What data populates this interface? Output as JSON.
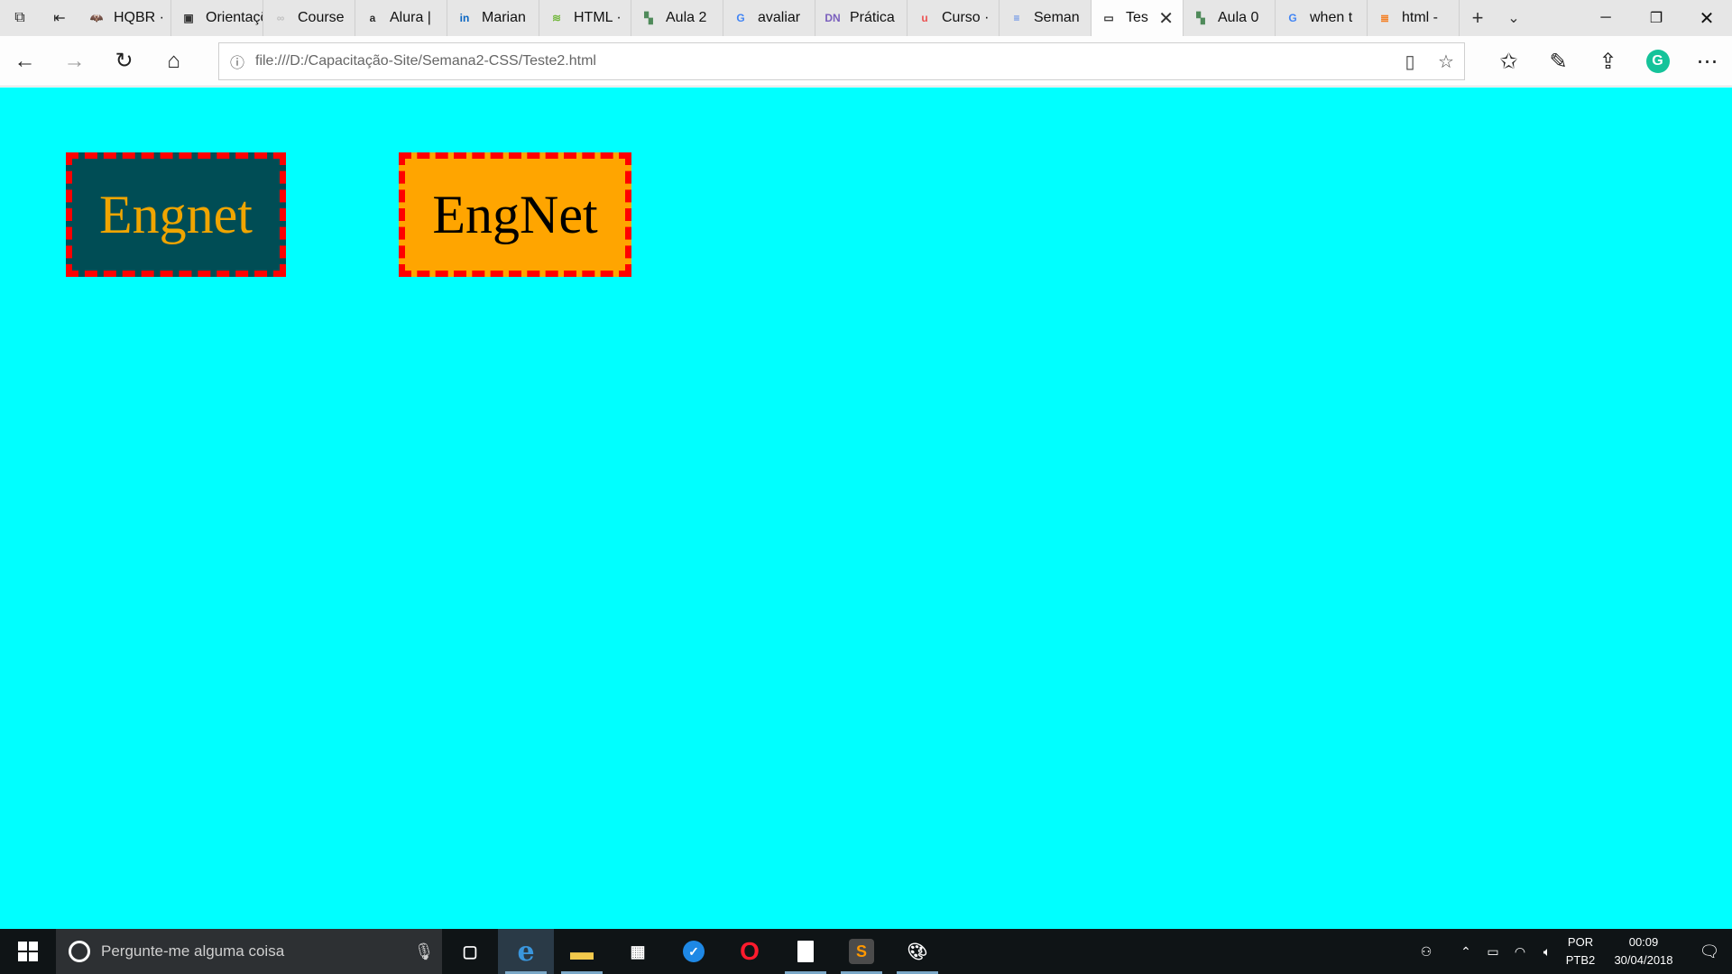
{
  "browser": {
    "tabs": [
      {
        "label": "HQBR ·",
        "icon": "batman-icon",
        "fav_text": "🦇",
        "fav_color": "#f6c400"
      },
      {
        "label": "Orientações",
        "icon": "notebook-icon",
        "fav_text": "▣",
        "fav_color": "#333333"
      },
      {
        "label": "Course",
        "icon": "infinity-icon",
        "fav_text": "∞",
        "fav_color": "#c0c0c0"
      },
      {
        "label": "Alura |",
        "icon": "alura-icon",
        "fav_text": "a",
        "fav_color": "#2b2b2b"
      },
      {
        "label": "Marian",
        "icon": "linkedin-icon",
        "fav_text": "in",
        "fav_color": "#0a66c2"
      },
      {
        "label": "HTML ·",
        "icon": "html-icon",
        "fav_text": "≋",
        "fav_color": "#74b83f"
      },
      {
        "label": "Aula 2",
        "icon": "classroom-icon",
        "fav_text": "▚",
        "fav_color": "#4f8a5a"
      },
      {
        "label": "avaliar",
        "icon": "google-icon",
        "fav_text": "G",
        "fav_color": "#4285f4"
      },
      {
        "label": "Prática",
        "icon": "dn-icon",
        "fav_text": "DN",
        "fav_color": "#7a5fbd"
      },
      {
        "label": "Curso ·",
        "icon": "udemy-icon",
        "fav_text": "u",
        "fav_color": "#ec5252"
      },
      {
        "label": "Seman",
        "icon": "docs-icon",
        "fav_text": "≡",
        "fav_color": "#4a7ee8"
      },
      {
        "label": "Tes",
        "icon": "page-icon",
        "fav_text": "▭",
        "fav_color": "#333333",
        "active": true
      },
      {
        "label": "Aula 0",
        "icon": "classroom-icon",
        "fav_text": "▚",
        "fav_color": "#4f8a5a"
      },
      {
        "label": "when t",
        "icon": "google-icon",
        "fav_text": "G",
        "fav_color": "#4285f4"
      },
      {
        "label": "html -",
        "icon": "stackoverflow-icon",
        "fav_text": "≣",
        "fav_color": "#f48024"
      }
    ],
    "address": {
      "url": "file:///D:/Capacitação-Site/Semana2-CSS/Teste2.html"
    }
  },
  "page": {
    "background": "#00ffff",
    "box1": {
      "text": "Engnet",
      "bg": "#004d55",
      "color": "#f0a500",
      "border": "#ff0000"
    },
    "box2": {
      "text": "EngNet",
      "bg": "#ffa500",
      "color": "#000000",
      "border": "#ff0000"
    }
  },
  "taskbar": {
    "search_placeholder": "Pergunte-me alguma coisa",
    "apps": [
      {
        "name": "task-view-icon",
        "active": false
      },
      {
        "name": "edge-icon",
        "active": true
      },
      {
        "name": "file-explorer-icon",
        "active": false
      },
      {
        "name": "store-icon",
        "active": false
      },
      {
        "name": "tools-icon",
        "active": false
      },
      {
        "name": "opera-icon",
        "active": false
      },
      {
        "name": "blank-file-icon",
        "active": false
      },
      {
        "name": "sublime-text-icon",
        "active": false
      },
      {
        "name": "paint-icon",
        "active": false
      }
    ],
    "tray": {
      "lang_top": "POR",
      "lang_bottom": "PTB2",
      "time": "00:09",
      "date": "30/04/2018"
    }
  }
}
